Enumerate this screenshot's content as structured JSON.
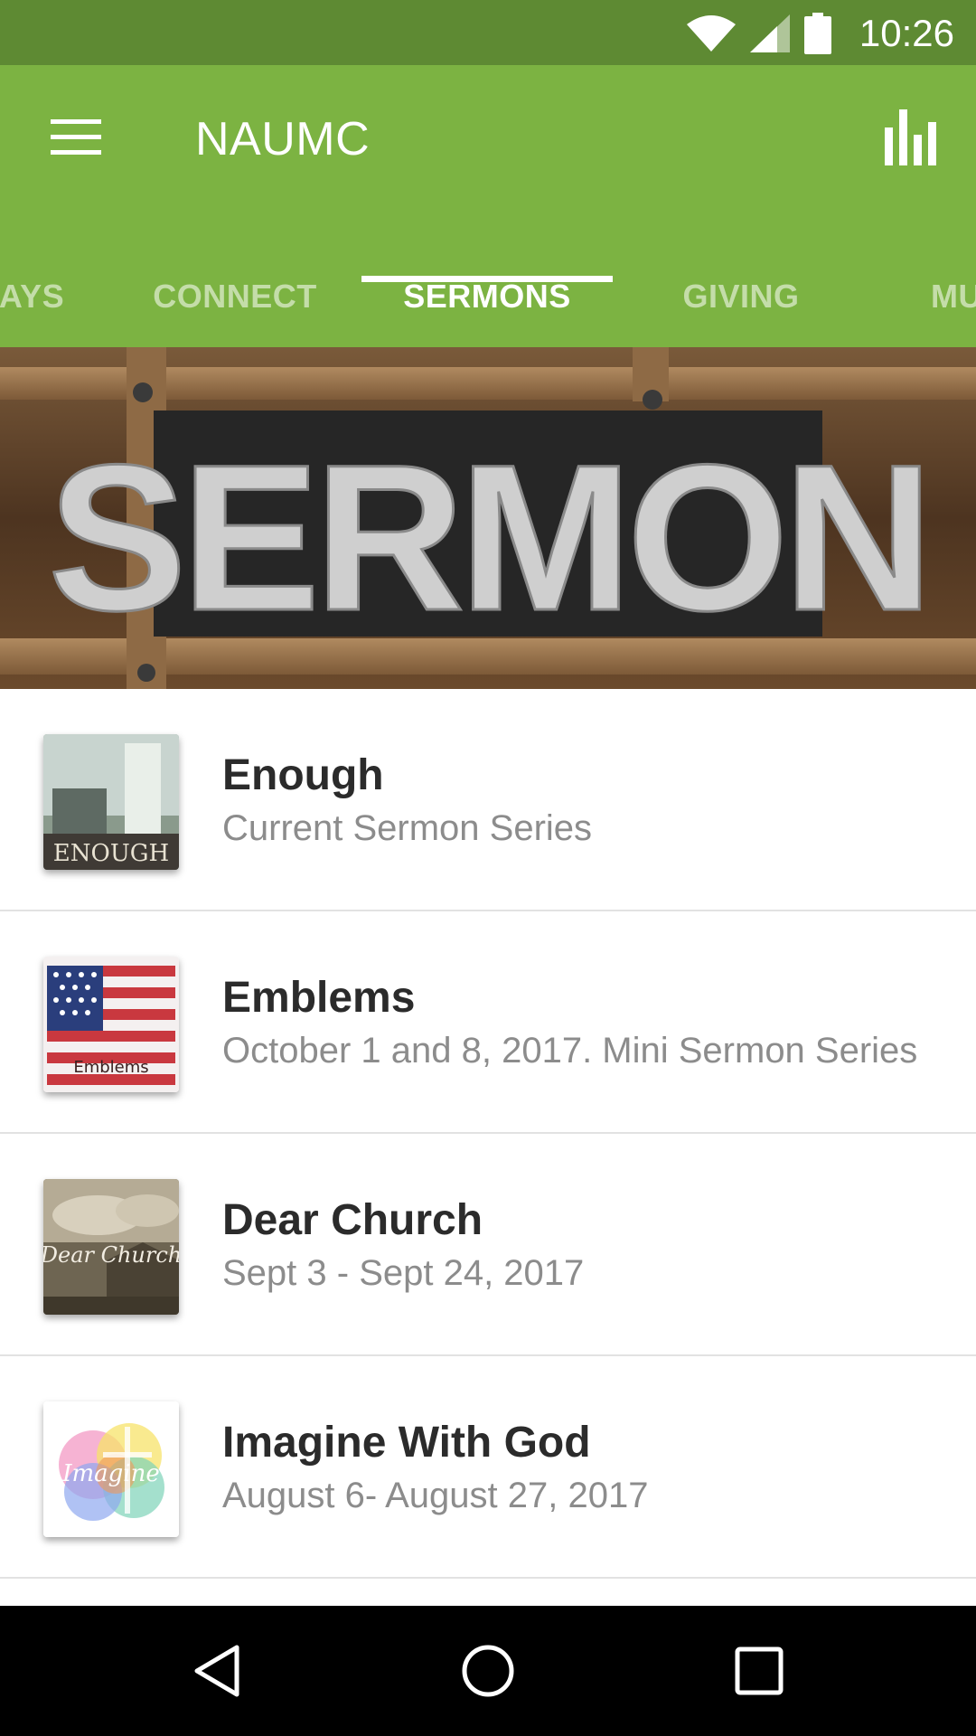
{
  "status_bar": {
    "time": "10:26",
    "icons": [
      "wifi-icon",
      "signal-icon",
      "battery-icon"
    ]
  },
  "app_bar": {
    "title": "NAUMC",
    "menu_icon": "hamburger-menu-icon",
    "action_icon": "bar-chart-icon",
    "color": "#7cb342"
  },
  "tabs": [
    {
      "label": "AYS",
      "active": false
    },
    {
      "label": "CONNECT",
      "active": false
    },
    {
      "label": "SERMONS",
      "active": true
    },
    {
      "label": "GIVING",
      "active": false
    },
    {
      "label": "MU",
      "active": false
    }
  ],
  "hero": {
    "text": "SERMON"
  },
  "sermons": [
    {
      "title": "Enough",
      "subtitle": "Current Sermon Series",
      "thumb_text": "ENOUGH"
    },
    {
      "title": "Emblems",
      "subtitle": "October 1 and 8, 2017.  Mini Sermon Series",
      "thumb_text": "Emblems"
    },
    {
      "title": "Dear Church",
      "subtitle": "Sept 3 - Sept 24, 2017",
      "thumb_text": "Dear Church"
    },
    {
      "title": "Imagine With God",
      "subtitle": "August 6- August 27, 2017",
      "thumb_text": "Imagine"
    }
  ],
  "nav_bar": {
    "buttons": [
      "back-icon",
      "home-icon",
      "recents-icon"
    ]
  }
}
